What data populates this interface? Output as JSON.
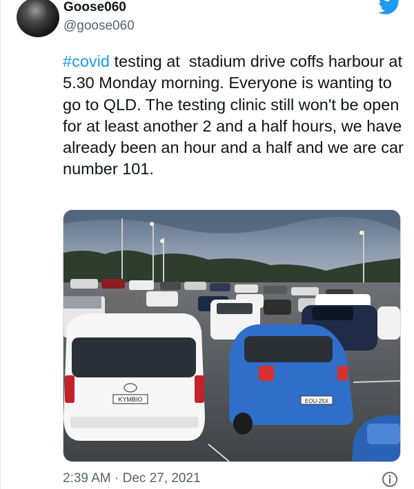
{
  "author": {
    "display_name": "Goose060",
    "handle": "@goose060"
  },
  "tweet": {
    "hashtag": "#covid",
    "text": " testing at  stadium drive coffs harbour at 5.30 Monday morning. Everyone is wanting to go to QLD. The testing clinic still won't be open for at least another 2 and a half hours, we have already been an hour and a half and we are car number 101.",
    "timestamp": "2:39 AM · Dec 27, 2021"
  },
  "photo": {
    "plate_white_car": "KYMBIO",
    "plate_blue_car": "EOU-25X"
  },
  "icons": {
    "brand": "twitter-bird-icon",
    "info": "info-icon"
  },
  "colors": {
    "accent": "#1d9bf0",
    "secondary_text": "#536471"
  }
}
